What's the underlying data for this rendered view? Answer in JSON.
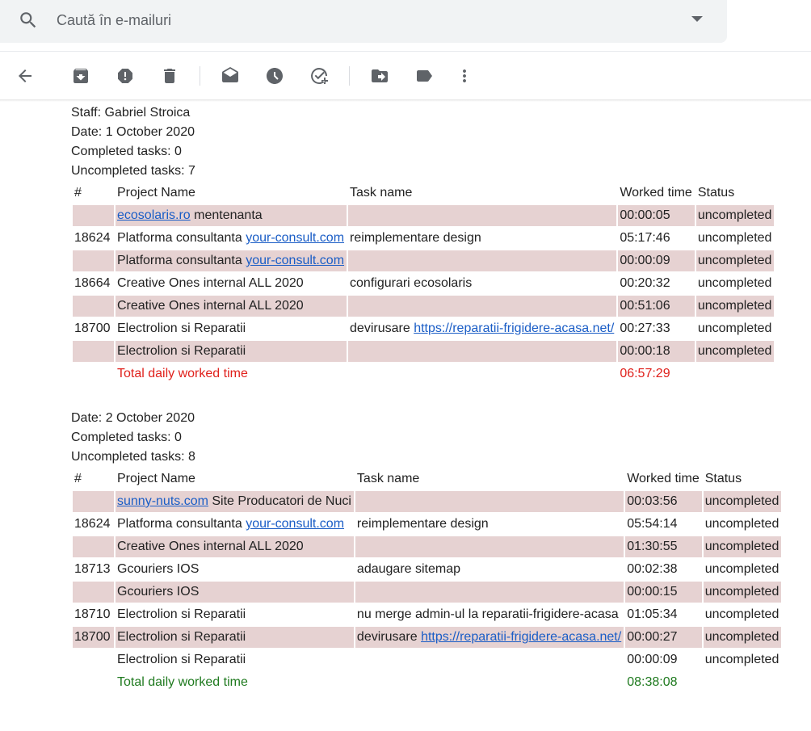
{
  "search": {
    "placeholder": "Caută în e-mailuri"
  },
  "toolbar": {
    "icons": [
      "back-icon",
      "archive-icon",
      "report-spam-icon",
      "delete-icon",
      "mark-unread-icon",
      "snooze-icon",
      "add-task-icon",
      "move-to-icon",
      "label-icon",
      "more-icon"
    ]
  },
  "report1": {
    "staff": "Staff: Gabriel Stroica",
    "date": "Date: 1 October 2020",
    "completed": "Completed tasks: 0",
    "uncompleted": "Uncompleted tasks: 7",
    "headers": {
      "num": "#",
      "project": "Project Name",
      "task": "Task name",
      "time": "Worked time",
      "status": "Status"
    },
    "rows": [
      {
        "num": "",
        "project_link": "ecosolaris.ro",
        "project": " mentenanta",
        "task": "",
        "task_link": "",
        "time": "00:00:05",
        "status": "uncompleted"
      },
      {
        "num": "18624",
        "project": "Platforma consultanta ",
        "project_link": "your-consult.com",
        "task": "reimplementare design",
        "task_link": "",
        "time": "05:17:46",
        "status": "uncompleted"
      },
      {
        "num": "",
        "project": "Platforma consultanta ",
        "project_link": "your-consult.com",
        "task": "",
        "task_link": "",
        "time": "00:00:09",
        "status": "uncompleted"
      },
      {
        "num": "18664",
        "project": "Creative Ones internal ALL 2020",
        "project_link": "",
        "task": "configurari ecosolaris",
        "task_link": "",
        "time": "00:20:32",
        "status": "uncompleted"
      },
      {
        "num": "",
        "project": "Creative Ones internal ALL 2020",
        "project_link": "",
        "task": "",
        "task_link": "",
        "time": "00:51:06",
        "status": "uncompleted"
      },
      {
        "num": "18700",
        "project": "Electrolion si Reparatii",
        "project_link": "",
        "task": "devirusare ",
        "task_link": "https://reparatii-frigidere-acasa.net/",
        "time": "00:27:33",
        "status": "uncompleted"
      },
      {
        "num": "",
        "project": "Electrolion si Reparatii",
        "project_link": "",
        "task": "",
        "task_link": "",
        "time": "00:00:18",
        "status": "uncompleted"
      }
    ],
    "total_label": "Total daily worked time",
    "total_time": "06:57:29"
  },
  "report2": {
    "date": "Date: 2 October 2020",
    "completed": "Completed tasks: 0",
    "uncompleted": "Uncompleted tasks: 8",
    "headers": {
      "num": "#",
      "project": "Project Name",
      "task": "Task name",
      "time": "Worked time",
      "status": "Status"
    },
    "rows": [
      {
        "num": "",
        "project_link": "sunny-nuts.com",
        "project": " Site Producatori de Nuci",
        "task": "",
        "task_link": "",
        "time": "00:03:56",
        "status": "uncompleted"
      },
      {
        "num": "18624",
        "project": "Platforma consultanta ",
        "project_link": "your-consult.com",
        "task": "reimplementare design",
        "task_link": "",
        "time": "05:54:14",
        "status": "uncompleted"
      },
      {
        "num": "",
        "project": "Creative Ones internal ALL 2020",
        "project_link": "",
        "task": "",
        "task_link": "",
        "time": "01:30:55",
        "status": "uncompleted"
      },
      {
        "num": "18713",
        "project": "Gcouriers IOS",
        "project_link": "",
        "task": "adaugare sitemap",
        "task_link": "",
        "time": "00:02:38",
        "status": "uncompleted"
      },
      {
        "num": "",
        "project": "Gcouriers IOS",
        "project_link": "",
        "task": "",
        "task_link": "",
        "time": "00:00:15",
        "status": "uncompleted"
      },
      {
        "num": "18710",
        "project": "Electrolion si Reparatii",
        "project_link": "",
        "task": "nu merge admin-ul la reparatii-frigidere-acasa",
        "task_link": "",
        "time": "01:05:34",
        "status": "uncompleted"
      },
      {
        "num": "18700",
        "project": "Electrolion si Reparatii",
        "project_link": "",
        "task": "devirusare ",
        "task_link": "https://reparatii-frigidere-acasa.net/",
        "time": "00:00:27",
        "status": "uncompleted"
      },
      {
        "num": "",
        "project": "Electrolion si Reparatii",
        "project_link": "",
        "task": "",
        "task_link": "",
        "time": "00:00:09",
        "status": "uncompleted"
      }
    ],
    "total_label": "Total daily worked time",
    "total_time": "08:38:08"
  },
  "colors": {
    "shade": "#e6d2d2",
    "link": "#1a5dc6",
    "total1": "#e0211c",
    "total2": "#1f7a1f"
  }
}
